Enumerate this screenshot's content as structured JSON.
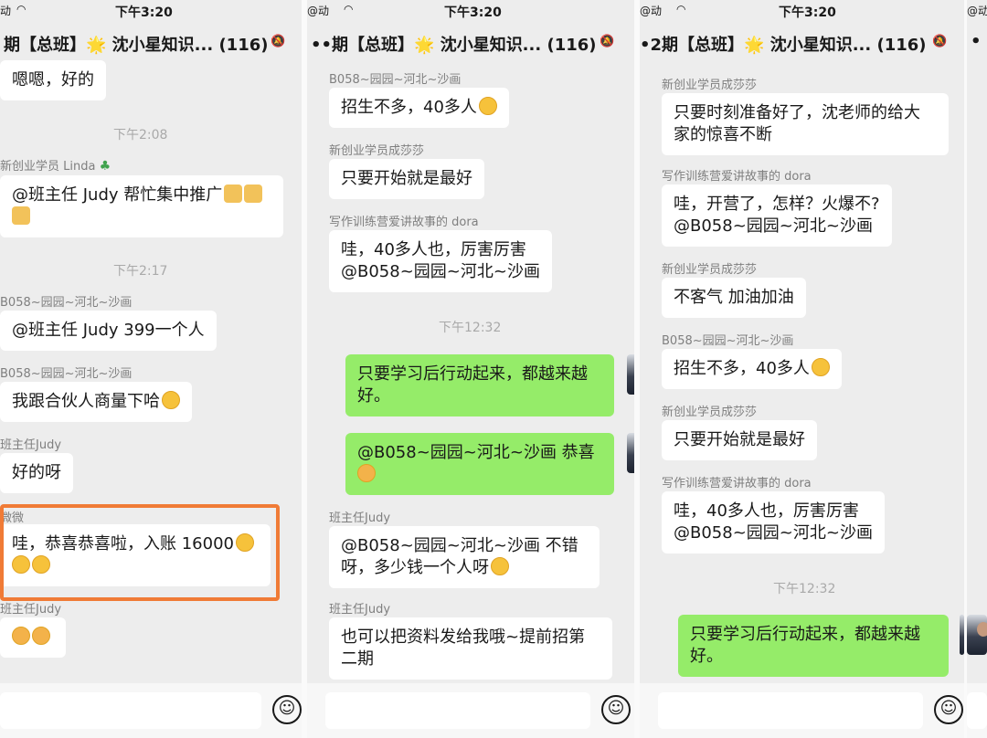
{
  "status": {
    "time": "下午3:20",
    "carrier_fragment": "@动",
    "carrier_fragment_left": "动"
  },
  "chat": {
    "title_full": "期【总班】🌟 沈小星知识... (116)",
    "title_p1": "期【总班】🌟 沈小星知识... (116)",
    "title_p2": "••期【总班】🌟 沈小星知识... (116)",
    "title_p3": "•2期【总班】🌟 沈小星知识... (116)"
  },
  "panel1": {
    "m0": "嗯嗯，好的",
    "t1": "下午2:08",
    "s1": "新创业学员 Linda",
    "m1": "@班主任 Judy 帮忙集中推广",
    "t2": "下午2:17",
    "s2": "B058~园园~河北~沙画",
    "m2": "@班主任 Judy  399一个人",
    "s3": "B058~园园~河北~沙画",
    "m3": "我跟合伙人商量下哈",
    "s4": "班主任Judy",
    "m4": "好的呀",
    "s5": "微微",
    "m5": "哇，恭喜恭喜啦，入账 16000",
    "s6": "班主任Judy"
  },
  "panel2": {
    "s1": "B058~园园~河北~沙画",
    "m1": "招生不多，40多人",
    "s2": "新创业学员成莎莎",
    "m2": "只要开始就是最好",
    "s3": "写作训练营爱讲故事的 dora",
    "m3": "哇，40多人也，厉害厉害\n@B058~园园~河北~沙画",
    "t1": "下午12:32",
    "m4": "只要学习后行动起来，都越来越\n好。",
    "m5": "@B058~园园~河北~沙画 恭喜",
    "s6": "班主任Judy",
    "m6": "@B058~园园~河北~沙画 不错\n呀，多少钱一个人呀",
    "s7": "班主任Judy",
    "m7": "也可以把资料发给我哦~提前招第\n二期"
  },
  "panel3": {
    "s1": "新创业学员成莎莎",
    "m1": "只要时刻准备好了，沈老师的给大\n家的惊喜不断",
    "s2": "写作训练营爱讲故事的 dora",
    "m2": "哇，开营了，怎样？火爆不?\n@B058~园园~河北~沙画",
    "s3": "新创业学员成莎莎",
    "m3": "不客气  加油加油",
    "s4": "B058~园园~河北~沙画",
    "m4": "招生不多，40多人",
    "s5": "新创业学员成莎莎",
    "m5": "只要开始就是最好",
    "s6": "写作训练营爱讲故事的 dora",
    "m6": "哇，40多人也，厉害厉害\n@B058~园园~河北~沙画",
    "t1": "下午12:32",
    "m7": "只要学习后行动起来，都越来越\n好。"
  },
  "icons": {
    "emoji_button": "☺",
    "plus_button": "+"
  },
  "colors": {
    "bg": "#ededed",
    "self_bubble": "#95ec69",
    "other_bubble": "#ffffff",
    "highlight": "#f07b36"
  }
}
